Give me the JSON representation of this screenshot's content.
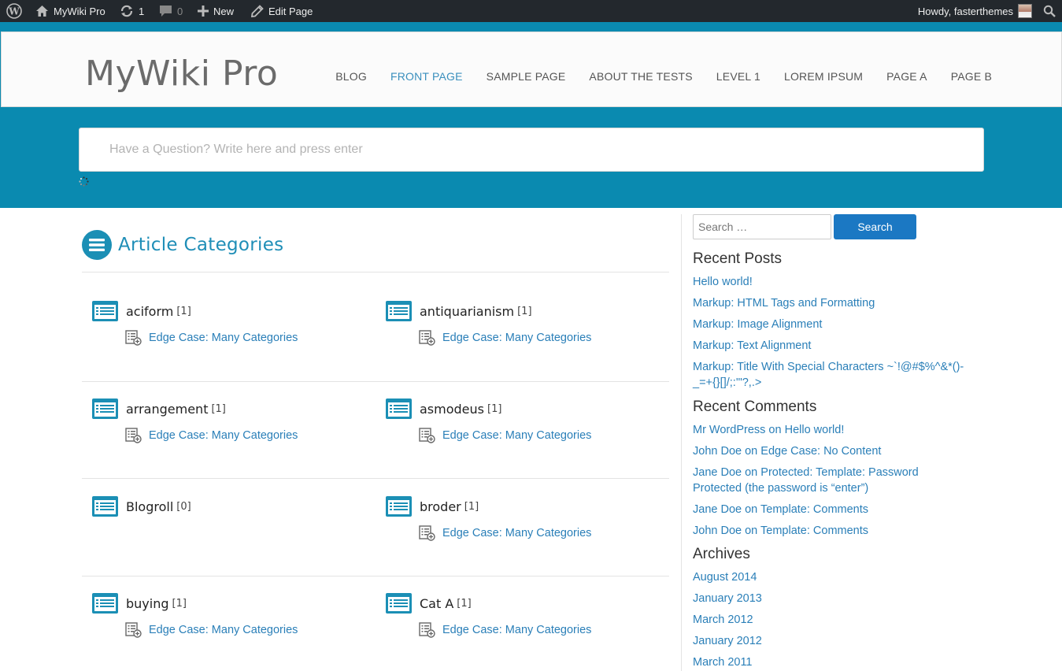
{
  "admin_bar": {
    "site_name": "MyWiki Pro",
    "updates_count": "1",
    "comments_count": "0",
    "new_label": "New",
    "edit_label": "Edit Page",
    "greeting": "Howdy, fasterthemes"
  },
  "header": {
    "site_title": "MyWiki Pro",
    "nav": [
      "BLOG",
      "FRONT PAGE",
      "SAMPLE PAGE",
      "ABOUT THE TESTS",
      "LEVEL 1",
      "LOREM IPSUM",
      "PAGE A",
      "PAGE B"
    ],
    "current_nav": "FRONT PAGE"
  },
  "question_search": {
    "placeholder": "Have a Question? Write here and press enter"
  },
  "main": {
    "heading": "Article Categories",
    "categories": [
      {
        "name": "aciform",
        "count": "[1]",
        "post": "Edge Case: Many Categories"
      },
      {
        "name": "antiquarianism",
        "count": "[1]",
        "post": "Edge Case: Many Categories"
      },
      {
        "name": "arrangement",
        "count": "[1]",
        "post": "Edge Case: Many Categories"
      },
      {
        "name": "asmodeus",
        "count": "[1]",
        "post": "Edge Case: Many Categories"
      },
      {
        "name": "Blogroll",
        "count": "[0]",
        "post": ""
      },
      {
        "name": "broder",
        "count": "[1]",
        "post": "Edge Case: Many Categories"
      },
      {
        "name": "buying",
        "count": "[1]",
        "post": "Edge Case: Many Categories"
      },
      {
        "name": "Cat A",
        "count": "[1]",
        "post": "Edge Case: Many Categories"
      }
    ]
  },
  "sidebar": {
    "search_placeholder": "Search …",
    "search_button": "Search",
    "recent_posts_title": "Recent Posts",
    "recent_posts": [
      "Hello world!",
      "Markup: HTML Tags and Formatting",
      "Markup: Image Alignment",
      "Markup: Text Alignment",
      "Markup: Title With Special Characters ~`!@#$%^&*()-_=+{}[]/;:'\"?,.>"
    ],
    "recent_comments_title": "Recent Comments",
    "recent_comments": [
      {
        "author": "Mr WordPress",
        "on": "on",
        "post": "Hello world!"
      },
      {
        "author": "John Doe",
        "on": "on",
        "post": "Edge Case: No Content"
      },
      {
        "author": "Jane Doe",
        "on": "on",
        "post": "Protected: Template: Password Protected (the password is “enter”)"
      },
      {
        "author": "Jane Doe",
        "on": "on",
        "post": "Template: Comments"
      },
      {
        "author": "John Doe",
        "on": "on",
        "post": "Template: Comments"
      }
    ],
    "archives_title": "Archives",
    "archives": [
      "August 2014",
      "January 2013",
      "March 2012",
      "January 2012",
      "March 2011"
    ]
  },
  "colors": {
    "teal_band": "#0a8ab0",
    "link": "#2a7fb8",
    "accent": "#1b8fb5",
    "search_button": "#1b78c3"
  }
}
